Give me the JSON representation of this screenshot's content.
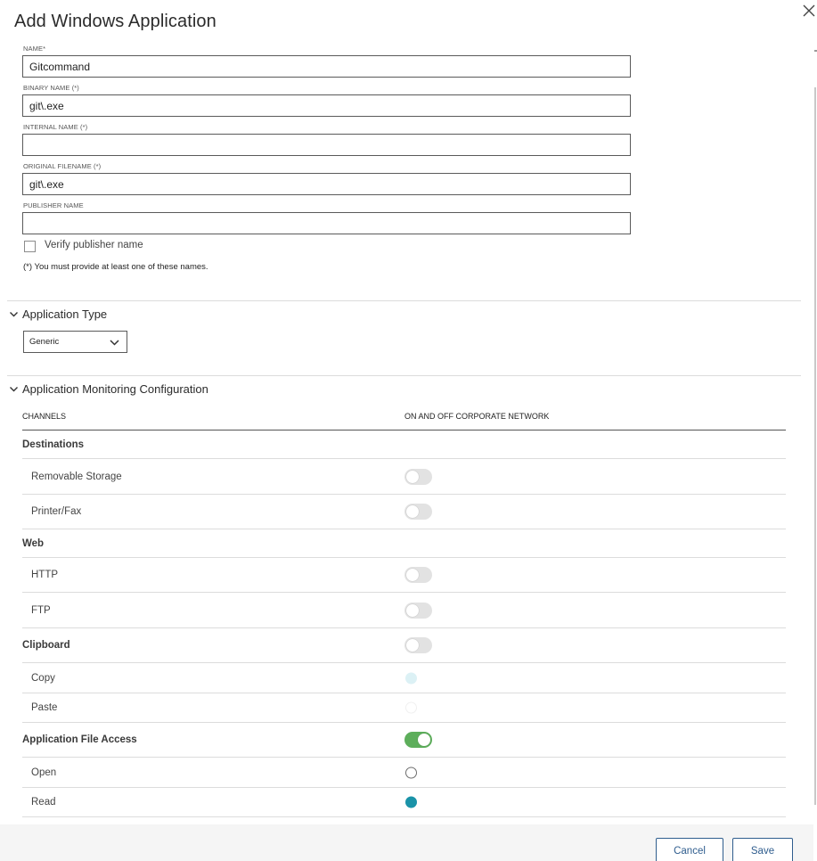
{
  "dialog": {
    "title": "Add Windows Application",
    "close_icon": "close-icon"
  },
  "fields": {
    "name": {
      "label": "NAME*",
      "value": "Gitcommand",
      "placeholder": ""
    },
    "binary_name": {
      "label": "BINARY NAME (*)",
      "value": "git\\.exe",
      "placeholder": ""
    },
    "internal_name": {
      "label": "INTERNAL NAME (*)",
      "value": "",
      "placeholder": ""
    },
    "original_filename": {
      "label": "ORIGINAL FILENAME (*)",
      "value": "git\\.exe",
      "placeholder": ""
    },
    "publisher_name": {
      "label": "PUBLISHER NAME",
      "value": "",
      "placeholder": ""
    }
  },
  "verify_publisher": {
    "label": "Verify publisher name",
    "checked": false
  },
  "names_note": "(*) You must provide at least one of these names.",
  "application_type": {
    "title": "Application Type",
    "selected": "Generic"
  },
  "monitoring": {
    "title": "Application Monitoring Configuration",
    "columns": [
      "CHANNELS",
      "ON AND OFF CORPORATE NETWORK"
    ],
    "rows": [
      {
        "label": "Destinations",
        "kind": "group",
        "control": "none"
      },
      {
        "label": "Removable Storage",
        "kind": "sub",
        "control": "toggle",
        "on": false
      },
      {
        "label": "Printer/Fax",
        "kind": "sub",
        "control": "toggle",
        "on": false
      },
      {
        "label": "Web",
        "kind": "group",
        "control": "none"
      },
      {
        "label": "HTTP",
        "kind": "sub",
        "control": "toggle",
        "on": false
      },
      {
        "label": "FTP",
        "kind": "sub",
        "control": "toggle",
        "on": false
      },
      {
        "label": "Clipboard",
        "kind": "group",
        "control": "toggle",
        "on": false
      },
      {
        "label": "Copy",
        "kind": "sub",
        "control": "radio",
        "state": "disabled-selected"
      },
      {
        "label": "Paste",
        "kind": "sub",
        "control": "radio",
        "state": "disabled-unselected"
      },
      {
        "label": "Application File Access",
        "kind": "group",
        "control": "toggle",
        "on": true
      },
      {
        "label": "Open",
        "kind": "sub",
        "control": "radio",
        "state": "unselected"
      },
      {
        "label": "Read",
        "kind": "sub",
        "control": "radio",
        "state": "selected"
      }
    ]
  },
  "footer": {
    "cancel_label": "Cancel",
    "save_label": "Save"
  },
  "colors": {
    "toggle_on": "#5dae5b",
    "toggle_off": "#e2e2e2",
    "radio_selected": "#1a93a8",
    "button_border": "#2f5d8e"
  }
}
